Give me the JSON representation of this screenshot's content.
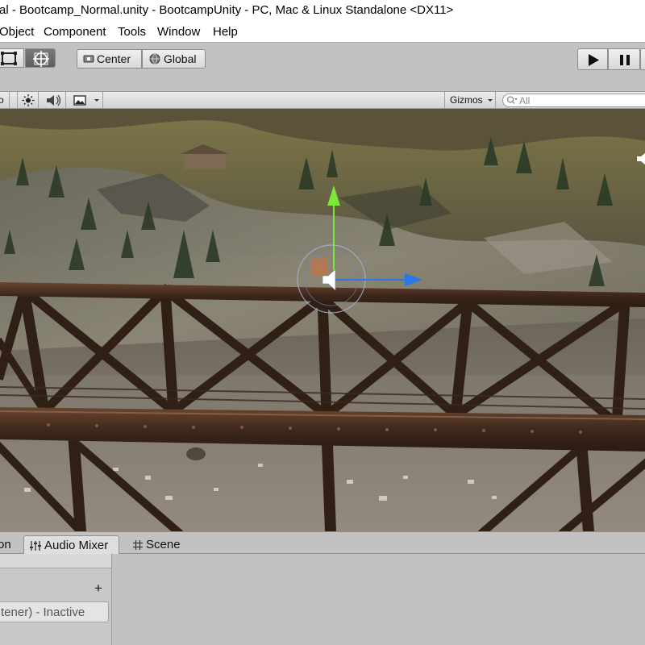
{
  "window": {
    "title": "al - Bootcamp_Normal.unity - BootcampUnity - PC, Mac & Linux Standalone <DX11>"
  },
  "menu": {
    "items": [
      {
        "label": "Object"
      },
      {
        "label": "Component"
      },
      {
        "label": "Tools"
      },
      {
        "label": "Window"
      },
      {
        "label": "Help"
      }
    ]
  },
  "toolbar": {
    "pivot_label": "Center",
    "rotation_label": "Global",
    "play_icon": "play-icon",
    "pause_icon": "pause-icon"
  },
  "scene_toolbar": {
    "left_stub": "o",
    "gizmos_label": "Gizmos",
    "search_placeholder": "All"
  },
  "bottom_tabs": {
    "partial_tab_label": "on",
    "audio_mixer_label": "Audio Mixer",
    "scene_label": "Scene"
  },
  "mixer": {
    "add_label": "+",
    "listener_text": "tener) - Inactive"
  },
  "colors": {
    "editor_gray": "#c2c2c2",
    "gizmo_up": "#7be83a",
    "gizmo_right": "#2a78e6",
    "gizmo_forward": "#e86b2a"
  }
}
